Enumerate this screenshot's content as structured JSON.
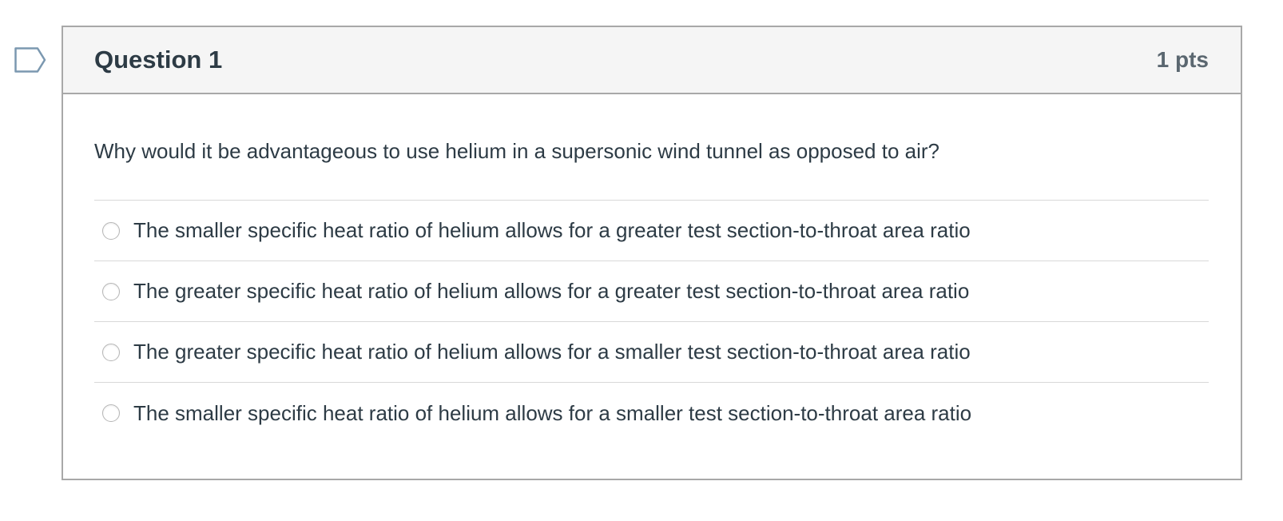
{
  "flag": {
    "icon": "flag-question-icon",
    "color": "#7b98b0"
  },
  "question": {
    "title": "Question 1",
    "points": "1 pts",
    "text": "Why would it be advantageous to use helium in a supersonic wind tunnel as opposed to air?",
    "answers": [
      {
        "label": "The smaller specific heat ratio of helium allows for a greater test section-to-throat area ratio",
        "selected": false
      },
      {
        "label": "The greater specific heat ratio of helium allows for a greater test section-to-throat area ratio",
        "selected": false
      },
      {
        "label": "The greater specific heat ratio of helium allows for a smaller test section-to-throat area ratio",
        "selected": false
      },
      {
        "label": "The smaller specific heat ratio of helium allows for a smaller test section-to-throat area ratio",
        "selected": false
      }
    ]
  }
}
